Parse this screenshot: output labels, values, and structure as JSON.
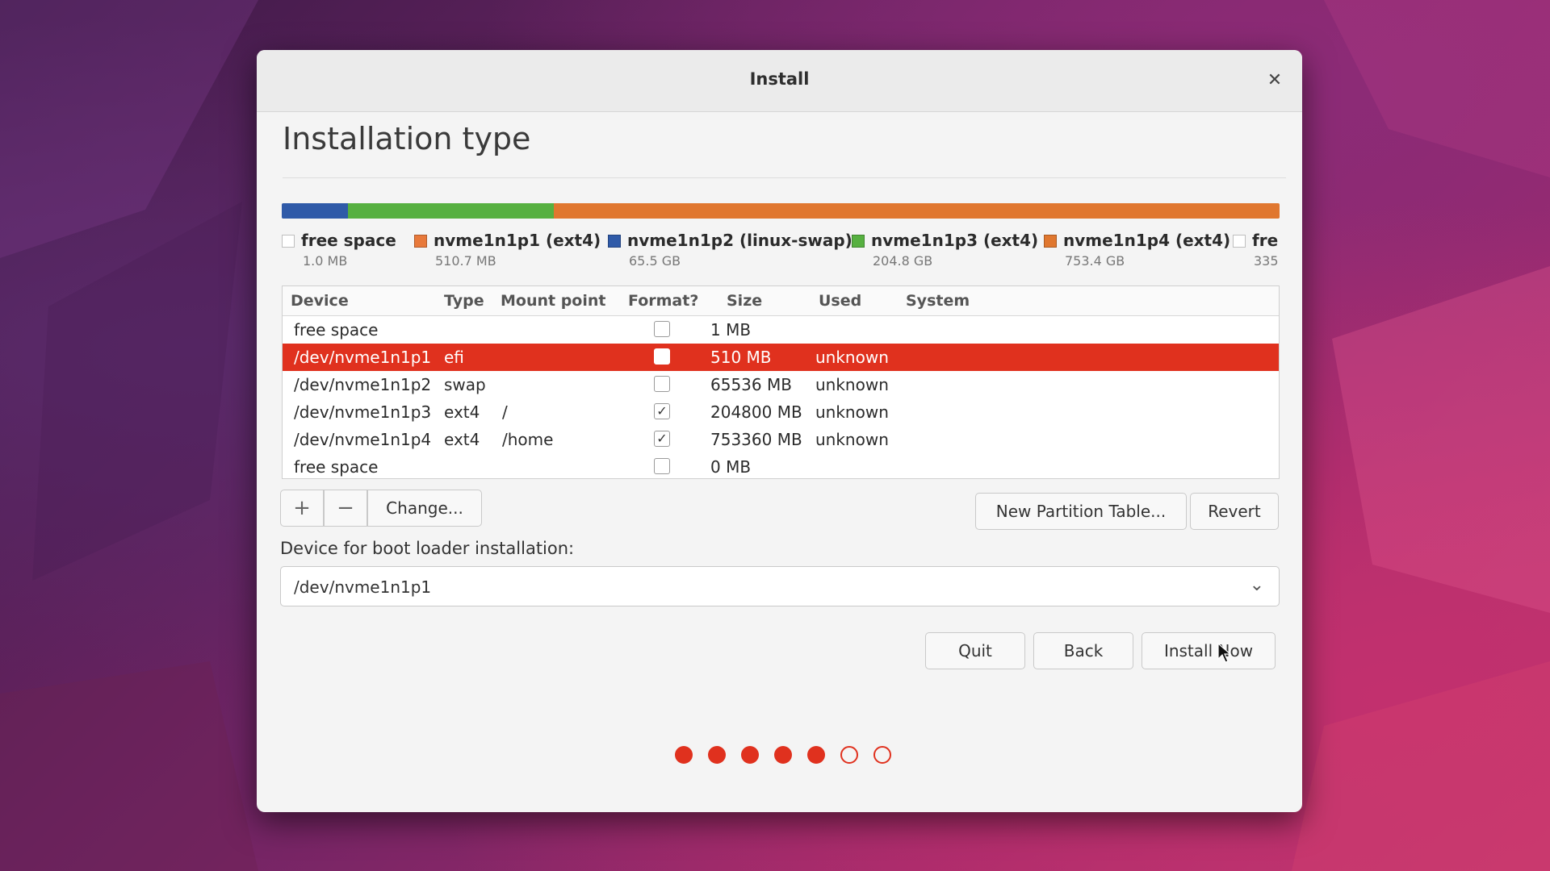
{
  "window": {
    "title": "Install"
  },
  "page": {
    "heading": "Installation type"
  },
  "colors": {
    "accent": "#e0311e",
    "free": "#ffffff",
    "p1": "#e8793b",
    "p2": "#2f5aa8",
    "p3": "#56b040",
    "p4": "#e0772f"
  },
  "legend": [
    {
      "name": "free space",
      "size": "1.0 MB",
      "color": "#ffffff"
    },
    {
      "name": "nvme1n1p1 (ext4)",
      "size": "510.7 MB",
      "color": "#e8793b"
    },
    {
      "name": "nvme1n1p2 (linux-swap)",
      "size": "65.5 GB",
      "color": "#2f5aa8"
    },
    {
      "name": "nvme1n1p3 (ext4)",
      "size": "204.8 GB",
      "color": "#56b040"
    },
    {
      "name": "nvme1n1p4 (ext4)",
      "size": "753.4 GB",
      "color": "#e0772f"
    },
    {
      "name": "fre",
      "size": "335",
      "color": "#ffffff"
    }
  ],
  "table": {
    "headers": [
      "Device",
      "Type",
      "Mount point",
      "Format?",
      "Size",
      "Used",
      "System"
    ],
    "rows": [
      {
        "device": "free space",
        "type": "",
        "mount": "",
        "format": false,
        "size": "1 MB",
        "used": "",
        "system": ""
      },
      {
        "device": "/dev/nvme1n1p1",
        "type": "efi",
        "mount": "",
        "format": false,
        "size": "510 MB",
        "used": "unknown",
        "system": "",
        "selected": true
      },
      {
        "device": "/dev/nvme1n1p2",
        "type": "swap",
        "mount": "",
        "format": false,
        "size": "65536 MB",
        "used": "unknown",
        "system": ""
      },
      {
        "device": "/dev/nvme1n1p3",
        "type": "ext4",
        "mount": "/",
        "format": true,
        "size": "204800 MB",
        "used": "unknown",
        "system": ""
      },
      {
        "device": "/dev/nvme1n1p4",
        "type": "ext4",
        "mount": "/home",
        "format": true,
        "size": "753360 MB",
        "used": "unknown",
        "system": ""
      },
      {
        "device": "free space",
        "type": "",
        "mount": "",
        "format": false,
        "size": "0 MB",
        "used": "",
        "system": ""
      }
    ]
  },
  "toolbar": {
    "add_icon": "+",
    "remove_icon": "−",
    "change_label": "Change...",
    "new_partition_table_label": "New Partition Table...",
    "revert_label": "Revert"
  },
  "bootloader": {
    "label": "Device for boot loader installation:",
    "value": "/dev/nvme1n1p1"
  },
  "actions": {
    "quit_label": "Quit",
    "back_label": "Back",
    "install_label": "Install Now"
  },
  "progress": {
    "total_steps": 7,
    "completed_steps": 5
  }
}
